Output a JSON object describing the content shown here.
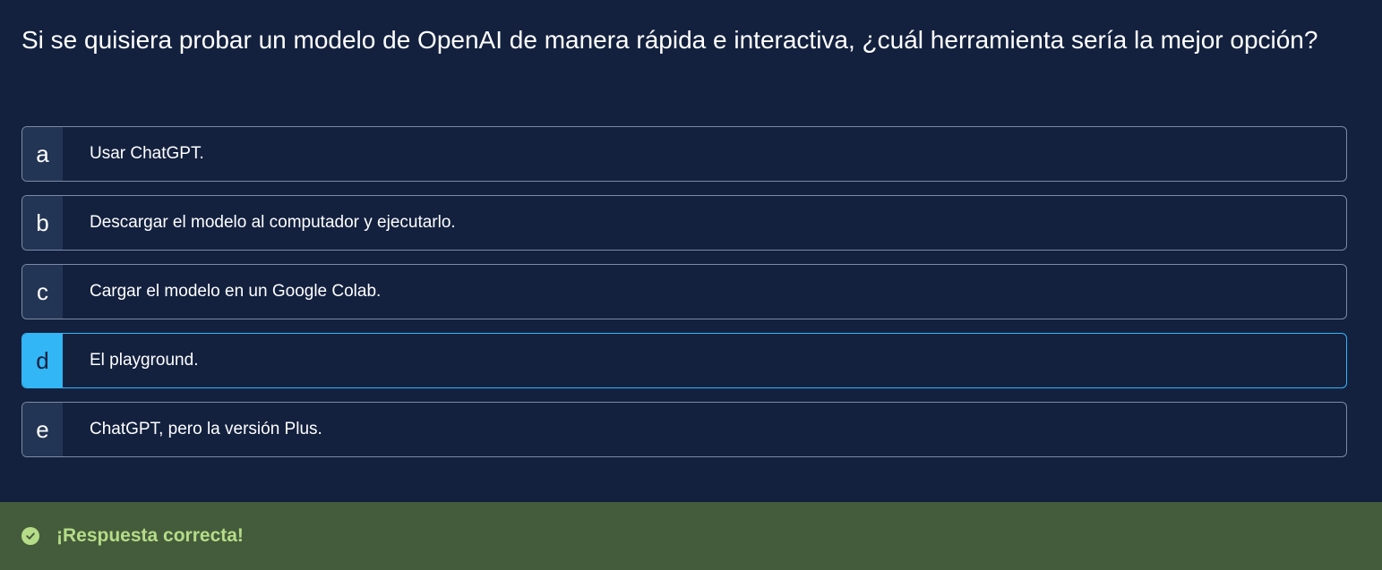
{
  "question": "Si se quisiera probar un modelo de OpenAI de manera rápida e interactiva, ¿cuál herramienta sería la mejor opción?",
  "options": [
    {
      "letter": "a",
      "text": "Usar ChatGPT."
    },
    {
      "letter": "b",
      "text": "Descargar el modelo al computador y ejecutarlo."
    },
    {
      "letter": "c",
      "text": "Cargar el modelo en un Google Colab."
    },
    {
      "letter": "d",
      "text": "El playground."
    },
    {
      "letter": "e",
      "text": "ChatGPT, pero la versión Plus."
    }
  ],
  "selected_option": "d",
  "feedback": {
    "icon": "check-circle-icon",
    "message": "¡Respuesta correcta!"
  },
  "colors": {
    "background": "#13213f",
    "accent": "#33b6f5",
    "success_bg": "#445c3c",
    "success_text": "#b5dc87"
  }
}
